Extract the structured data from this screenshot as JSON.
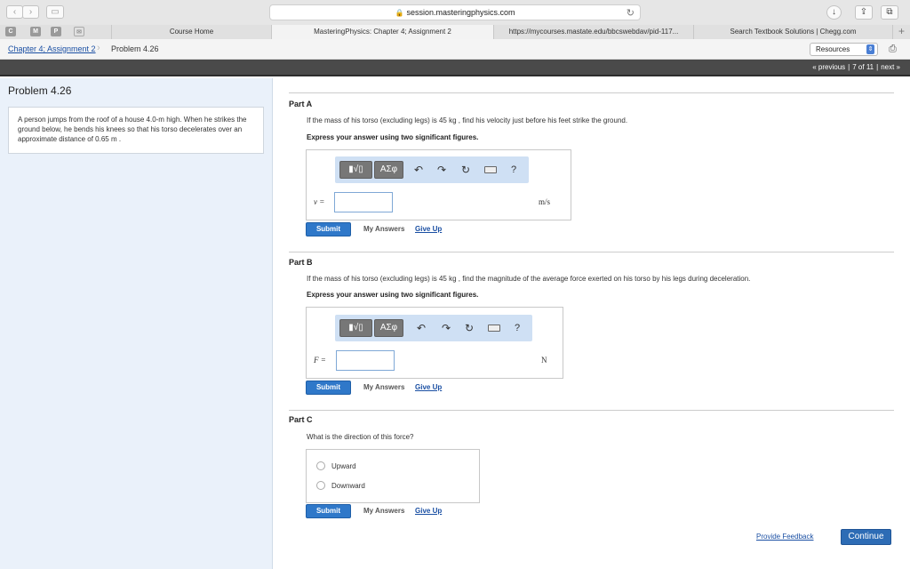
{
  "browser": {
    "url": "session.masteringphysics.com",
    "tabs": [
      {
        "label": "Course Home"
      },
      {
        "label": "MasteringPhysics: Chapter 4; Assignment 2"
      },
      {
        "label": "https://mycourses.mastate.edu/bbcswebdav/pid-117..."
      },
      {
        "label": "Search Textbook Solutions | Chegg.com"
      }
    ],
    "pinned": [
      "C",
      "M",
      "P"
    ]
  },
  "breadcrumb": {
    "assignment": "Chapter 4; Assignment 2",
    "current": "Problem 4.26"
  },
  "resources_label": "Resources",
  "nav": {
    "previous": "« previous",
    "position": "7 of 11",
    "next": "next »"
  },
  "problem": {
    "title": "Problem 4.26",
    "text": "A person jumps from the roof of a house 4.0-m high. When he strikes the ground below, he bends his knees so that his torso decelerates over an approximate distance of 0.65 m ."
  },
  "toolbar": {
    "template_label": "▮√▯",
    "greek_label": "ΑΣφ",
    "help_label": "?"
  },
  "parts": [
    {
      "label": "Part A",
      "question": "If the mass of his torso (excluding legs) is 45 kg , find his velocity just before his feet strike the ground.",
      "instruction": "Express your answer using two significant figures.",
      "variable": "v =",
      "unit": "m/s",
      "answer_value": ""
    },
    {
      "label": "Part B",
      "question": "If the mass of his torso (excluding legs) is 45 kg , find the magnitude of the average force exerted on his torso by his legs during deceleration.",
      "instruction": "Express your answer using two significant figures.",
      "variable": "F =",
      "unit": "N",
      "answer_value": ""
    },
    {
      "label": "Part C",
      "question": "What is the direction of this force?",
      "options": [
        "Upward",
        "Downward"
      ]
    }
  ],
  "actions": {
    "submit": "Submit",
    "my_answers": "My Answers",
    "give_up": "Give Up"
  },
  "footer": {
    "feedback": "Provide Feedback",
    "continue": "Continue"
  },
  "colors": {
    "accent": "#2f78c9",
    "left_panel": "#eaf1fa",
    "strip": "#4a4a4a",
    "toolbar": "#cfe0f4"
  }
}
